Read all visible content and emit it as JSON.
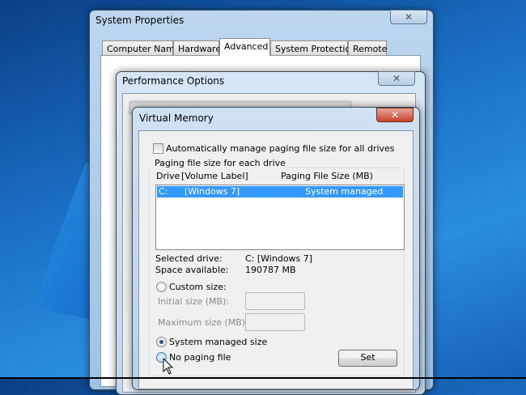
{
  "system_properties": {
    "title": "System Properties",
    "close": "✕",
    "tabs": [
      "Computer Name",
      "Hardware",
      "Advanced",
      "System Protection",
      "Remote"
    ],
    "selected_tab": "Advanced"
  },
  "performance_options": {
    "title": "Performance Options",
    "close": "✕"
  },
  "virtual_memory": {
    "title": "Virtual Memory",
    "close": "✕",
    "auto_manage_label": "Automatically manage paging file size for all drives",
    "auto_manage_checked": false,
    "group_label": "Paging file size for each drive",
    "columns": [
      "Drive",
      "[Volume Label]",
      "Paging File Size (MB)"
    ],
    "rows": [
      {
        "drive": "C:",
        "label": "[Windows 7]",
        "size": "System managed"
      }
    ],
    "selected_drive_label": "Selected drive:",
    "selected_drive_value": "C:  [Windows 7]",
    "space_available_label": "Space available:",
    "space_available_value": "190787 MB",
    "custom_size_label": "Custom size:",
    "initial_size_label": "Initial size (MB):",
    "initial_size_value": "",
    "maximum_size_label": "Maximum size (MB):",
    "maximum_size_value": "",
    "system_managed_label": "System managed size",
    "no_paging_label": "No paging file",
    "selected_option": "System managed size",
    "set_button": "Set"
  }
}
